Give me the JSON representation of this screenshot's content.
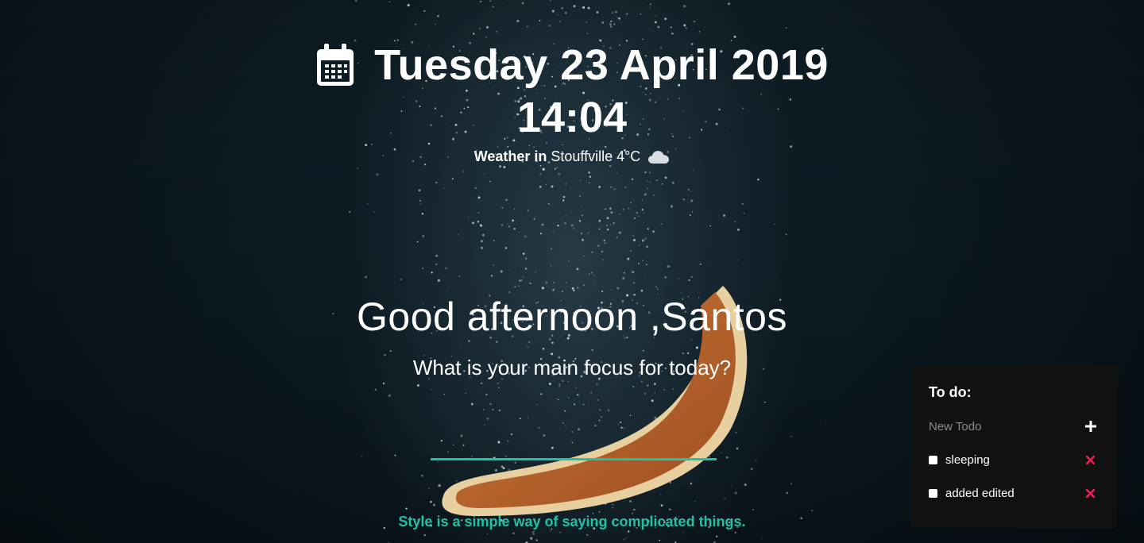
{
  "header": {
    "date": "Tuesday 23 April 2019",
    "time": "14:04",
    "weather_prefix": "Weather in",
    "weather_location": "Stouffville",
    "weather_temp": "4°C",
    "weather_icon": "cloud-icon",
    "date_icon": "calendar-icon"
  },
  "greeting": {
    "text": "Good afternoon ,Santos",
    "focus_question": "What is your main focus for today?",
    "focus_input_value": ""
  },
  "quote": "Style is a simple way of saying complicated things.",
  "todo": {
    "title": "To do:",
    "new_placeholder": "New Todo",
    "add_icon": "plus-icon",
    "items": [
      {
        "label": "sleeping",
        "checked": false
      },
      {
        "label": "added edited",
        "checked": false
      }
    ]
  },
  "colors": {
    "accent": "#1fc2a7",
    "delete": "#e8224f",
    "panel_bg": "#121212"
  }
}
